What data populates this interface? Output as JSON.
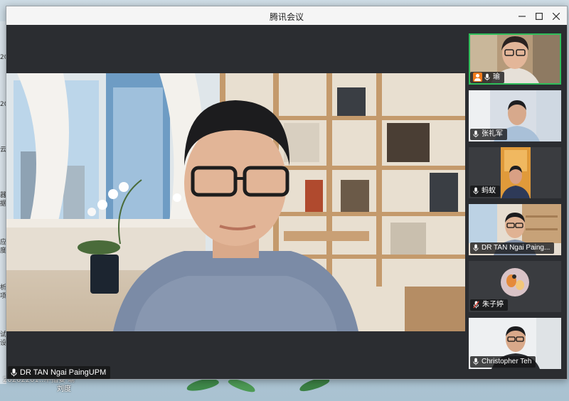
{
  "window": {
    "title": "腾讯会议"
  },
  "controls": {
    "minimize": "—",
    "maximize": "☐",
    "close": "✕"
  },
  "main_speaker": {
    "name": "DR TAN Ngai PaingUPM"
  },
  "participants": [
    {
      "name": "瑜",
      "active": true,
      "is_me": true,
      "muted": false
    },
    {
      "name": "张礼军",
      "active": false,
      "is_me": false,
      "muted": false
    },
    {
      "name": "蚂蚁",
      "active": false,
      "is_me": false,
      "muted": false
    },
    {
      "name": "DR TAN Ngai Paing...",
      "active": false,
      "is_me": false,
      "muted": false
    },
    {
      "name": "朱子婷",
      "active": false,
      "is_me": false,
      "muted": true
    },
    {
      "name": "Christopher Teh",
      "active": false,
      "is_me": false,
      "muted": false
    }
  ],
  "desktop": {
    "left_glyphs": [
      "20",
      "20",
      "云",
      "器",
      "据",
      "应",
      "度",
      "析",
      "项",
      "试",
      "设"
    ],
    "bottom_labels": [
      "20202201...",
      "中指委 瑜",
      "刘度"
    ]
  },
  "colors": {
    "active_border": "#2fbd5a",
    "me_badge": "#f07a1a",
    "mute_red": "#e0463a"
  }
}
